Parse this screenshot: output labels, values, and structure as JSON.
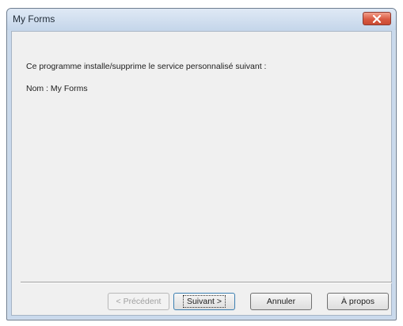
{
  "window": {
    "title": "My Forms",
    "close_icon": "close-icon"
  },
  "content": {
    "message": "Ce programme installe/supprime le service personnalisé suivant :",
    "name_line": "Nom : My Forms"
  },
  "buttons": {
    "previous": "< Précédent",
    "next": "Suivant >",
    "cancel": "Annuler",
    "about": "À propos"
  },
  "colors": {
    "close_button": "#d95a42",
    "frame": "#c9d9ec",
    "client": "#f0f0f0"
  }
}
